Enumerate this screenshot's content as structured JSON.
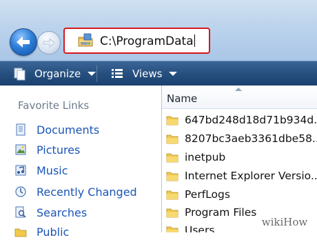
{
  "address_bar": {
    "path": "C:\\ProgramData"
  },
  "toolbar": {
    "organize_label": "Organize",
    "views_label": "Views"
  },
  "nav_pane": {
    "heading": "Favorite Links",
    "items": [
      {
        "label": "Documents",
        "icon": "documents-icon"
      },
      {
        "label": "Pictures",
        "icon": "pictures-icon"
      },
      {
        "label": "Music",
        "icon": "music-icon"
      },
      {
        "label": "Recently Changed",
        "icon": "recently-changed-icon"
      },
      {
        "label": "Searches",
        "icon": "searches-icon"
      },
      {
        "label": "Public",
        "icon": "public-folder-icon"
      }
    ]
  },
  "file_list": {
    "column_name": "Name",
    "rows": [
      {
        "name": "647bd248d18d71b934d..."
      },
      {
        "name": "8207bc3aeb3361dbe58..."
      },
      {
        "name": "inetpub"
      },
      {
        "name": "Internet Explorer Versio..."
      },
      {
        "name": "PerfLogs"
      },
      {
        "name": "Program Files"
      },
      {
        "name": "Users"
      }
    ]
  },
  "watermark": {
    "text": "wikiHow"
  },
  "colors": {
    "highlight_border": "#d7161d",
    "link_blue": "#1a55b8",
    "toolbar_blue": "#26507f",
    "folder_yellow": "#f2c94c"
  }
}
